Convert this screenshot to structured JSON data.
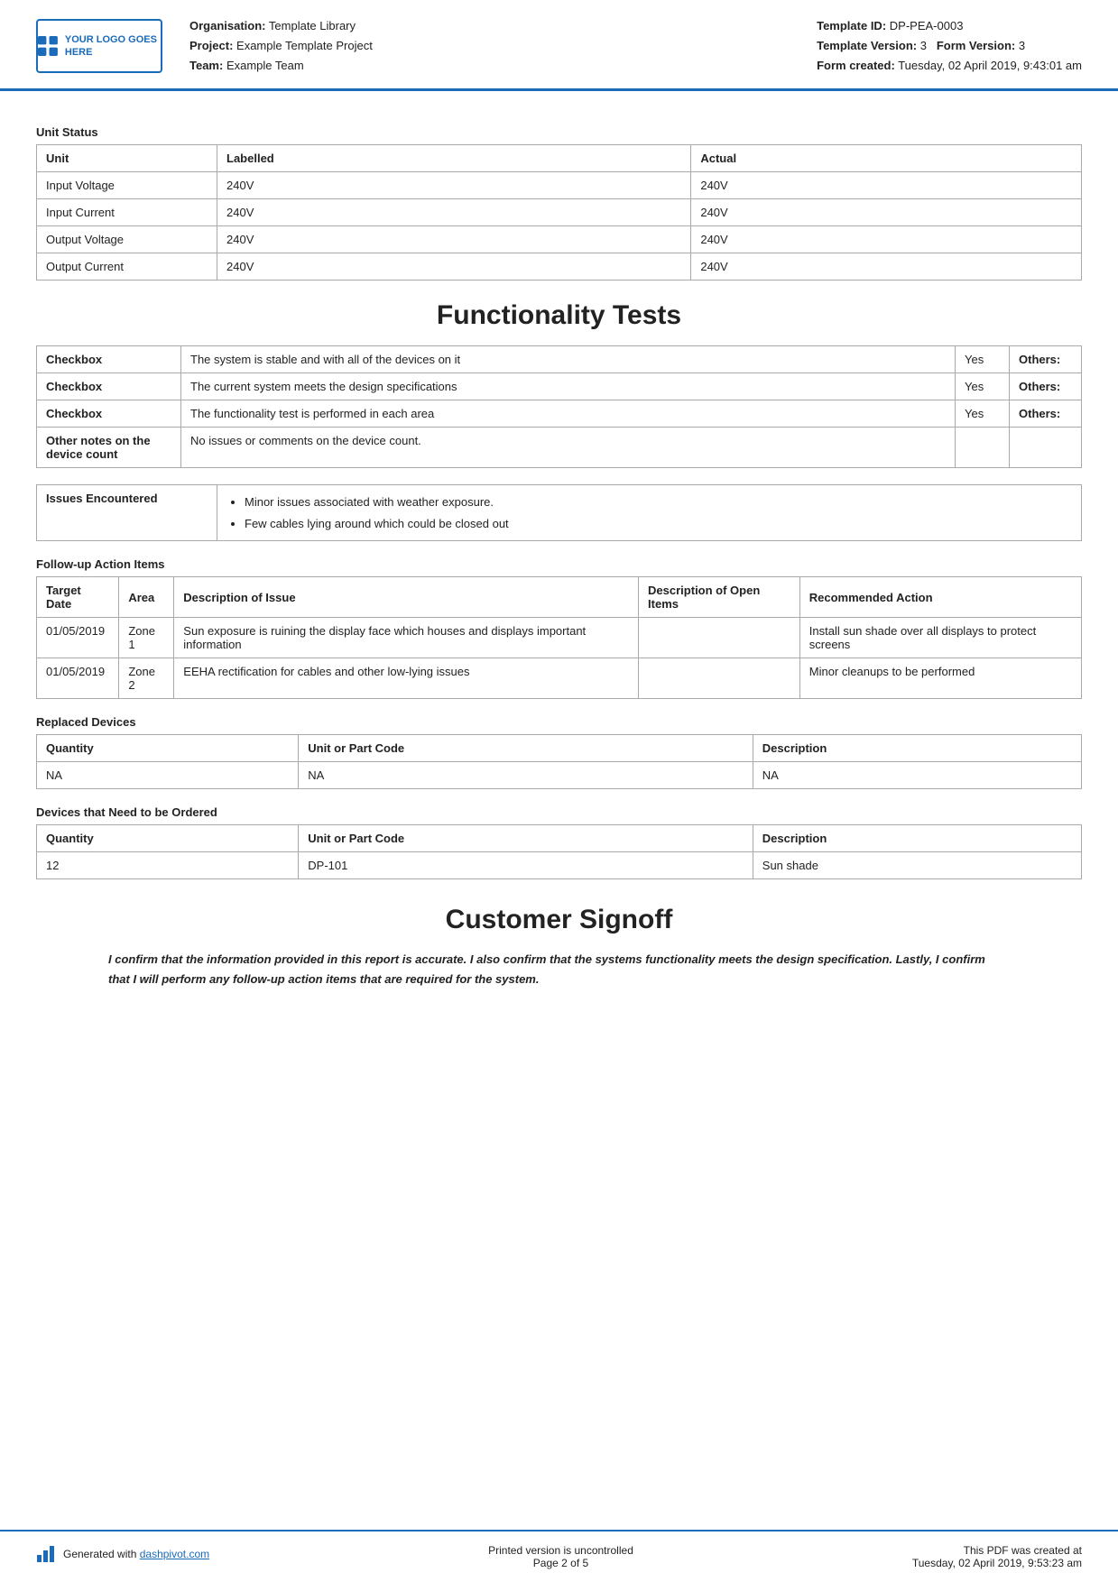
{
  "header": {
    "logo_text": "YOUR LOGO GOES HERE",
    "org_label": "Organisation:",
    "org_value": "Template Library",
    "project_label": "Project:",
    "project_value": "Example Template Project",
    "team_label": "Team:",
    "team_value": "Example Team",
    "template_id_label": "Template ID:",
    "template_id_value": "DP-PEA-0003",
    "template_version_label": "Template Version:",
    "template_version_value": "3",
    "form_version_label": "Form Version:",
    "form_version_value": "3",
    "form_created_label": "Form created:",
    "form_created_value": "Tuesday, 02 April 2019, 9:43:01 am"
  },
  "unit_status": {
    "section_title": "Unit Status",
    "columns": [
      "Unit",
      "Labelled",
      "Actual"
    ],
    "rows": [
      [
        "Input Voltage",
        "240V",
        "240V"
      ],
      [
        "Input Current",
        "240V",
        "240V"
      ],
      [
        "Output Voltage",
        "240V",
        "240V"
      ],
      [
        "Output Current",
        "240V",
        "240V"
      ]
    ]
  },
  "functionality": {
    "heading": "Functionality Tests",
    "rows": [
      {
        "label": "Checkbox",
        "description": "The system is stable and with all of the devices on it",
        "value": "Yes",
        "others_label": "Others:"
      },
      {
        "label": "Checkbox",
        "description": "The current system meets the design specifications",
        "value": "Yes",
        "others_label": "Others:"
      },
      {
        "label": "Checkbox",
        "description": "The functionality test is performed in each area",
        "value": "Yes",
        "others_label": "Others:"
      },
      {
        "label": "Other notes on the device count",
        "description": "No issues or comments on the device count.",
        "value": "",
        "others_label": ""
      }
    ],
    "issues_label": "Issues Encountered",
    "issues": [
      "Minor issues associated with weather exposure.",
      "Few cables lying around which could be closed out"
    ]
  },
  "followup": {
    "section_title": "Follow-up Action Items",
    "columns": [
      "Target Date",
      "Area",
      "Description of Issue",
      "Description of Open Items",
      "Recommended Action"
    ],
    "rows": [
      {
        "target_date": "01/05/2019",
        "area": "Zone 1",
        "description": "Sun exposure is ruining the display face which houses and displays important information",
        "open_items": "",
        "recommended": "Install sun shade over all displays to protect screens"
      },
      {
        "target_date": "01/05/2019",
        "area": "Zone 2",
        "description": "EEHA rectification for cables and other low-lying issues",
        "open_items": "",
        "recommended": "Minor cleanups to be performed"
      }
    ]
  },
  "replaced_devices": {
    "section_title": "Replaced Devices",
    "columns": [
      "Quantity",
      "Unit or Part Code",
      "Description"
    ],
    "rows": [
      [
        "NA",
        "NA",
        "NA"
      ]
    ]
  },
  "ordered_devices": {
    "section_title": "Devices that Need to be Ordered",
    "columns": [
      "Quantity",
      "Unit or Part Code",
      "Description"
    ],
    "rows": [
      [
        "12",
        "DP-101",
        "Sun shade"
      ]
    ]
  },
  "signoff": {
    "heading": "Customer Signoff",
    "text": "I confirm that the information provided in this report is accurate. I also confirm that the systems functionality meets the design specification. Lastly, I confirm that I will perform any follow-up action items that are required for the system."
  },
  "footer": {
    "generated_text": "Generated with",
    "link_text": "dashpivot.com",
    "uncontrolled": "Printed version is uncontrolled",
    "page": "Page 2 of 5",
    "pdf_label": "This PDF was created at",
    "pdf_date": "Tuesday, 02 April 2019, 9:53:23 am"
  }
}
